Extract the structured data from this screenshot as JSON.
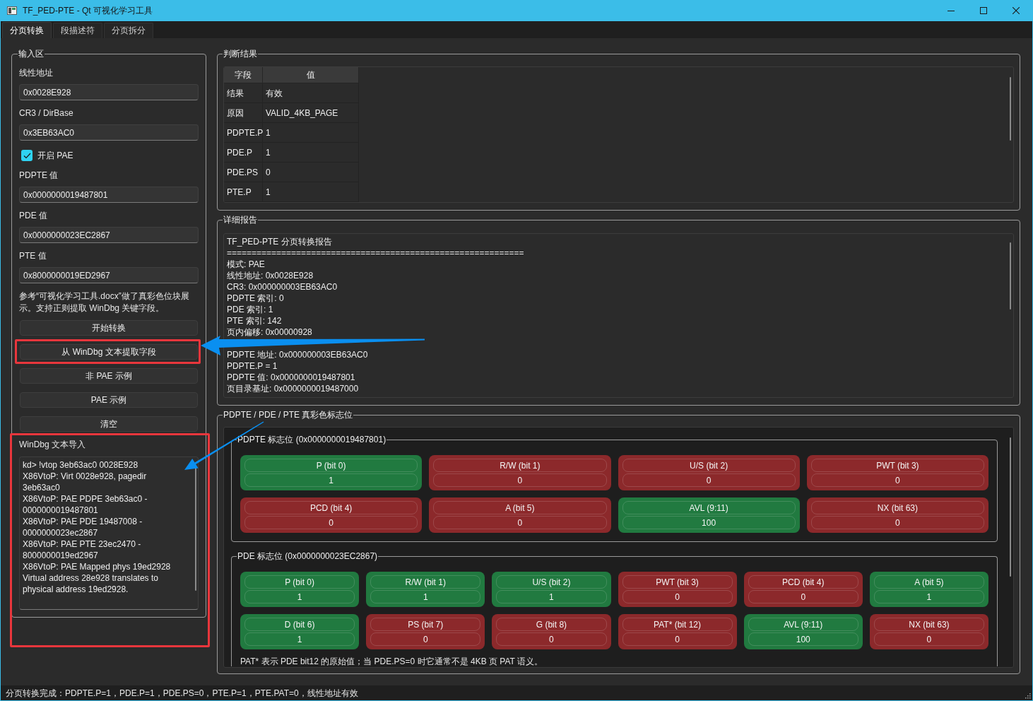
{
  "window": {
    "title": "TF_PED-PTE - Qt 可视化学习工具"
  },
  "tabs": [
    {
      "label": "分页转换",
      "selected": true
    },
    {
      "label": "段描述符",
      "selected": false
    },
    {
      "label": "分页拆分",
      "selected": false
    }
  ],
  "input_group": {
    "title": "输入区",
    "items": [
      {
        "kind": "field",
        "label": "线性地址",
        "value": "0x0028E928"
      },
      {
        "kind": "field",
        "label": "CR3 / DirBase",
        "value": "0x3EB63AC0"
      },
      {
        "kind": "checkbox",
        "label": "开启 PAE",
        "checked": true
      },
      {
        "kind": "field",
        "label": "PDPTE 值",
        "value": "0x0000000019487801"
      },
      {
        "kind": "field",
        "label": "PDE 值",
        "value": "0x0000000023EC2867"
      },
      {
        "kind": "field",
        "label": "PTE 值",
        "value": "0x8000000019ED2967"
      }
    ],
    "note": "参考“可视化学习工具.docx”做了真彩色位块展示。支持正则提取 WinDbg 关键字段。",
    "buttons": [
      "开始转换",
      "从 WinDbg 文本提取字段",
      "非 PAE 示例",
      "PAE 示例",
      "清空"
    ],
    "import_label": "WinDbg 文本导入",
    "import_text": "kd> !vtop 3eb63ac0 0028E928\nX86VtoP: Virt 0028e928, pagedir 3eb63ac0\nX86VtoP: PAE PDPE 3eb63ac0 - 0000000019487801\nX86VtoP: PAE PDE 19487008 - 0000000023ec2867\nX86VtoP: PAE PTE 23ec2470 - 8000000019ed2967\nX86VtoP: PAE Mapped phys 19ed2928\nVirtual address 28e928 translates to physical address 19ed2928."
  },
  "results": {
    "title": "判断结果",
    "columns": [
      "字段",
      "值"
    ],
    "rows": [
      {
        "field": "结果",
        "value": "有效"
      },
      {
        "field": "原因",
        "value": "VALID_4KB_PAGE"
      },
      {
        "field": "PDPTE.P",
        "value": "1"
      },
      {
        "field": "PDE.P",
        "value": "1"
      },
      {
        "field": "PDE.PS",
        "value": "0"
      },
      {
        "field": "PTE.P",
        "value": "1"
      }
    ]
  },
  "report": {
    "title": "详细报告",
    "lines": [
      "TF_PED-PTE 分页转换报告",
      "============================================================",
      "模式: PAE",
      "线性地址: 0x0028E928",
      "CR3: 0x000000003EB63AC0",
      "PDPTE 索引: 0",
      "PDE 索引: 1",
      "PTE 索引: 142",
      "页内偏移: 0x00000928",
      "PDPTE 地址: 0x000000003EB63AC0",
      "PDPTE.P = 1",
      "PDPTE 值: 0x0000000019487801",
      "页目录基址: 0x0000000019487000"
    ]
  },
  "flags": {
    "title": "PDPTE / PDE / PTE 真彩色标志位",
    "sections": [
      {
        "title": "PDPTE 标志位 (0x0000000019487801)",
        "flags": [
          {
            "label": "P (bit 0)",
            "value": "1",
            "set": true
          },
          {
            "label": "R/W (bit 1)",
            "value": "0",
            "set": false
          },
          {
            "label": "U/S (bit 2)",
            "value": "0",
            "set": false
          },
          {
            "label": "PWT (bit 3)",
            "value": "0",
            "set": false
          },
          {
            "label": "PCD (bit 4)",
            "value": "0",
            "set": false
          },
          {
            "label": "A (bit 5)",
            "value": "0",
            "set": false
          },
          {
            "label": "AVL (9:11)",
            "value": "100",
            "set": true
          },
          {
            "label": "NX (bit 63)",
            "value": "0",
            "set": false
          }
        ]
      },
      {
        "title": "PDE 标志位 (0x0000000023EC2867)",
        "flags": [
          {
            "label": "P (bit 0)",
            "value": "1",
            "set": true
          },
          {
            "label": "R/W (bit 1)",
            "value": "1",
            "set": true
          },
          {
            "label": "U/S (bit 2)",
            "value": "1",
            "set": true
          },
          {
            "label": "PWT (bit 3)",
            "value": "0",
            "set": false
          },
          {
            "label": "PCD (bit 4)",
            "value": "0",
            "set": false
          },
          {
            "label": "A (bit 5)",
            "value": "1",
            "set": true
          },
          {
            "label": "D (bit 6)",
            "value": "1",
            "set": true
          },
          {
            "label": "PS (bit 7)",
            "value": "0",
            "set": false
          },
          {
            "label": "G (bit 8)",
            "value": "0",
            "set": false
          },
          {
            "label": "PAT* (bit 12)",
            "value": "0",
            "set": false
          },
          {
            "label": "AVL (9:11)",
            "value": "100",
            "set": true
          },
          {
            "label": "NX (bit 63)",
            "value": "0",
            "set": false
          }
        ],
        "note": "PAT* 表示 PDE bit12 的原始值；当 PDE.PS=0 时它通常不是 4KB 页 PAT 语义。"
      }
    ]
  },
  "status_bar": {
    "text": "分页转换完成：PDPTE.P=1，PDE.P=1，PDE.PS=0，PTE.P=1，PTE.PAT=0，线性地址有效"
  }
}
